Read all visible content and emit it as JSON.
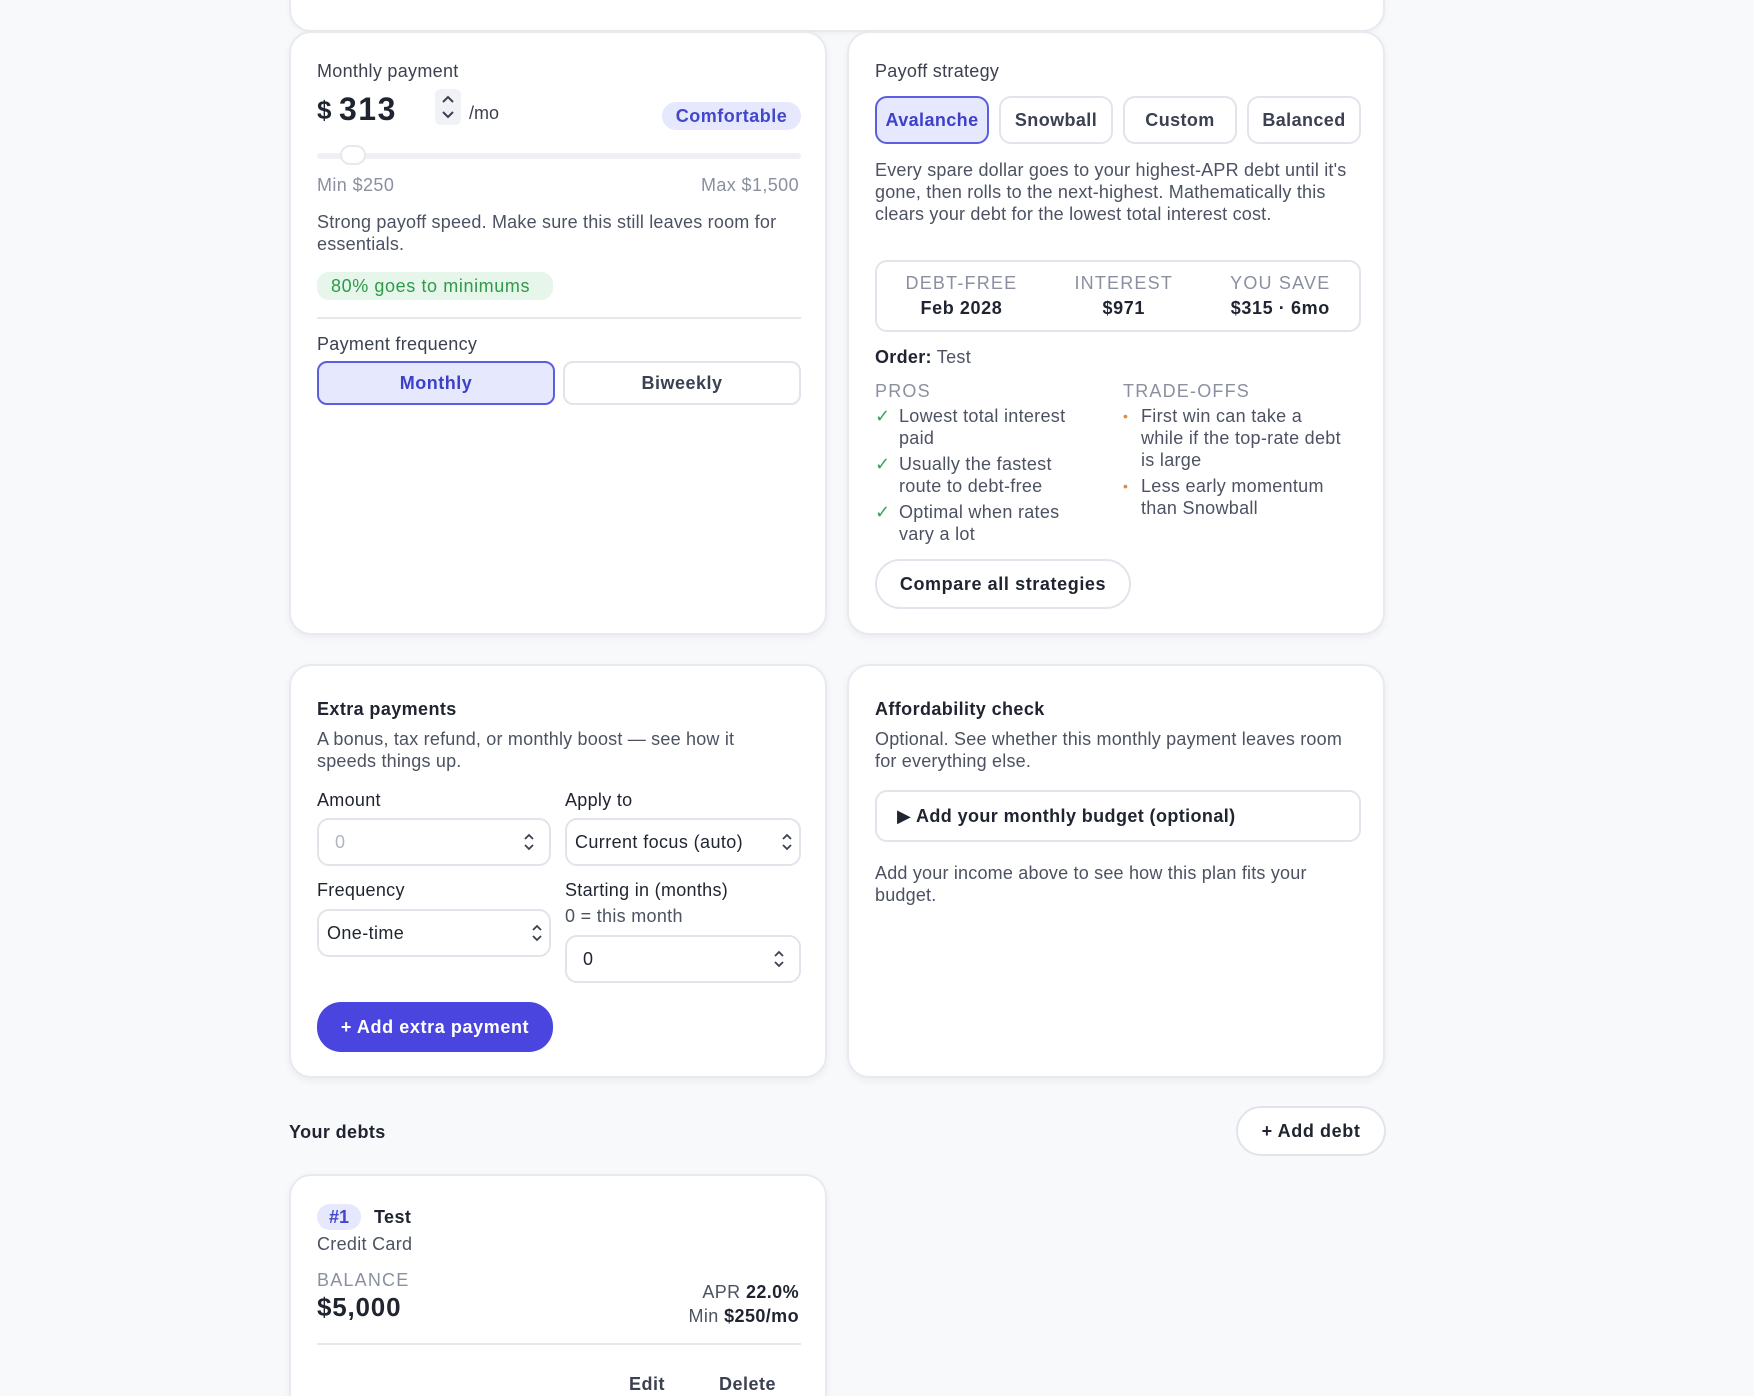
{
  "payment": {
    "title": "Monthly payment",
    "currency": "$",
    "amount": "313",
    "unit": "/mo",
    "badge": "Comfortable",
    "slider_fraction": 0.05,
    "min_label": "Min $250",
    "max_label": "Max $1,500",
    "note": "Strong payoff speed. Make sure this still leaves room for essentials.",
    "minimums_badge": "80% goes to minimums",
    "frequency_label": "Payment frequency",
    "frequency_options": [
      "Monthly",
      "Biweekly"
    ]
  },
  "strategy": {
    "title": "Payoff strategy",
    "tabs": [
      "Avalanche",
      "Snowball",
      "Custom",
      "Balanced"
    ],
    "description": "Every spare dollar goes to your highest-APR debt until it's gone, then rolls to the next-highest. Mathematically this clears your debt for the lowest total interest cost.",
    "stats": [
      {
        "label": "DEBT-FREE",
        "value": "Feb 2028"
      },
      {
        "label": "INTEREST",
        "value": "$971"
      },
      {
        "label": "YOU SAVE",
        "value": "$315 · 6mo"
      }
    ],
    "order_label": "Order:",
    "order_value": "Test",
    "pros_title": "PROS",
    "pros": [
      "Lowest total interest paid",
      "Usually the fastest route to debt-free",
      "Optimal when rates vary a lot"
    ],
    "tradeoffs_title": "TRADE-OFFS",
    "tradeoffs": [
      "First win can take a while if the top-rate debt is large",
      "Less early momentum than Snowball"
    ],
    "compare_button": "Compare all strategies"
  },
  "extra": {
    "title": "Extra payments",
    "description": "A bonus, tax refund, or monthly boost — see how it speeds things up.",
    "amount_label": "Amount",
    "amount_placeholder": "0",
    "apply_label": "Apply to",
    "apply_value": "Current focus (auto)",
    "frequency_label": "Frequency",
    "frequency_value": "One-time",
    "starting_label": "Starting in (months)",
    "starting_hint": "0 = this month",
    "starting_value": "0",
    "add_button": "+ Add extra payment"
  },
  "afford": {
    "title": "Affordability check",
    "description": "Optional. See whether this monthly payment leaves room for everything else.",
    "budget_toggle": "▶ Add your monthly budget (optional)",
    "hint": "Add your income above to see how this plan fits your budget."
  },
  "debts": {
    "title": "Your debts",
    "add_button": "+ Add debt",
    "items": [
      {
        "rank": "#1",
        "name": "Test",
        "type": "Credit Card",
        "balance_label": "BALANCE",
        "balance": "$5,000",
        "apr_label": "APR",
        "apr": "22.0%",
        "min_label": "Min",
        "min": "$250/mo",
        "edit": "Edit",
        "delete": "Delete"
      }
    ]
  },
  "colors": {
    "accent": "#4b45e0",
    "accent_light": "#e6e8fd",
    "success": "#2e9a4a",
    "warning": "#e08a3c"
  }
}
